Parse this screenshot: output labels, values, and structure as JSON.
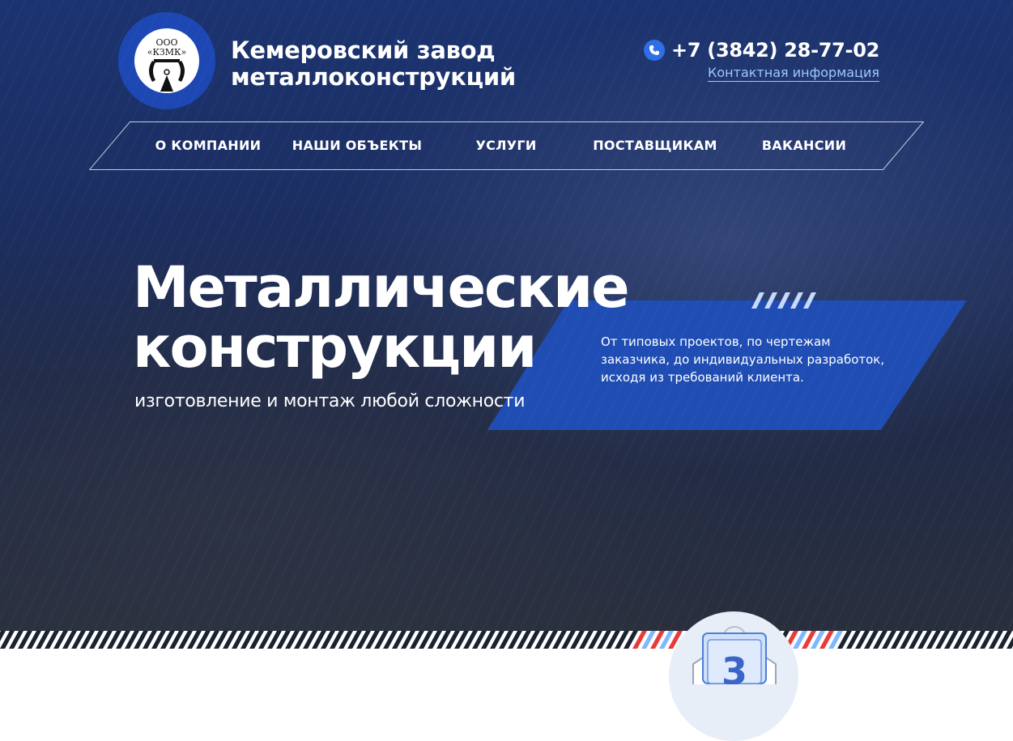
{
  "header": {
    "logo_text_top": "ООО",
    "logo_text_bottom": "«КЗМК»",
    "company_line1": "Кемеровский завод",
    "company_line2": "металлоконструкций",
    "phone": "+7 (3842) 28-77-02",
    "contact_link": "Контактная информация"
  },
  "nav": {
    "items": [
      {
        "label": "О КОМПАНИИ"
      },
      {
        "label": "НАШИ ОБЪЕКТЫ"
      },
      {
        "label": "УСЛУГИ"
      },
      {
        "label": "ПОСТАВЩИКАМ"
      },
      {
        "label": "ВАКАНСИИ"
      }
    ]
  },
  "hero": {
    "title_line1": "Металлические",
    "title_line2": "конструкции",
    "subtitle": "изготовление и монтаж любой сложности",
    "description": "От типовых проектов, по чертежам заказчика, до индивидуальных разработок, исходя из требований клиента."
  },
  "badge": {
    "number": "3"
  },
  "colors": {
    "accent_blue": "#1f4db3",
    "phone_icon": "#2e6ee6",
    "link": "#9ec7ff",
    "stripe_red": "#e83a3a",
    "stripe_light_blue": "#7fb8ff"
  }
}
